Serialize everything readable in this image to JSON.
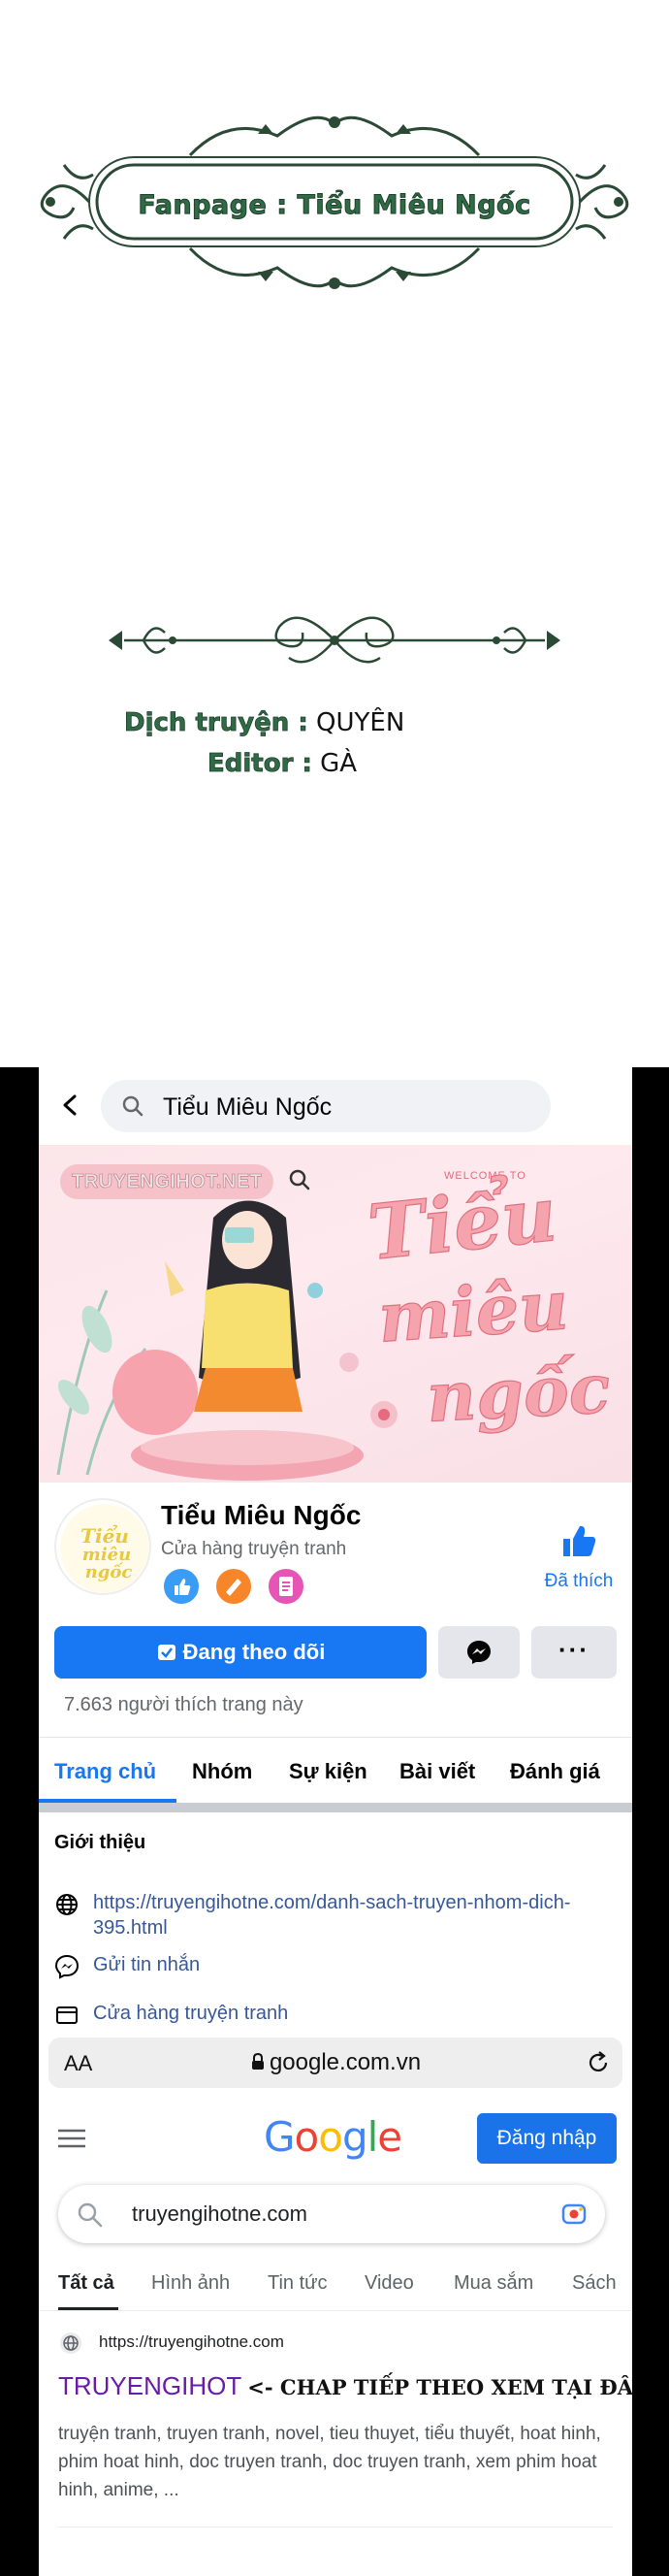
{
  "credits": {
    "fanpage": "Fanpage : Tiểu Miêu Ngốc",
    "translator_label": "Dịch truyện :",
    "translator": "QUYÊN",
    "editor_label": "Editor :",
    "editor": "GÀ",
    "accent_color": "#2f6b45"
  },
  "fb": {
    "search_query": "Tiểu Miêu Ngốc",
    "cover": {
      "site": "TRUYENGIHOT.NET",
      "welcome": "WELCOME TO",
      "title_lines": [
        "Tiểu",
        "miêu",
        "ngốc"
      ]
    },
    "page_name": "Tiểu Miêu Ngốc",
    "category": "Cửa hàng truyện tranh",
    "liked_label": "Đã thích",
    "follow_label": "Đang theo dõi",
    "more_label": "···",
    "likes_count": "7.663 người thích trang này",
    "tabs": [
      "Trang chủ",
      "Nhóm",
      "Sự kiện",
      "Bài viết",
      "Đánh giá"
    ],
    "intro": {
      "title": "Giới thiệu",
      "link": "https://truyengihotne.com/danh-sach-truyen-nhom-dich-395.html",
      "message": "Gửi tin nhắn",
      "shop": "Cửa hàng truyện tranh"
    },
    "brand_color": "#1877f2"
  },
  "browser": {
    "aa_label": "AA",
    "url": "google.com.vn"
  },
  "google": {
    "logo": "Google",
    "signin_label": "Đăng nhập",
    "query": "truyengihotne.com",
    "tabs": [
      "Tất cả",
      "Hình ảnh",
      "Tin tức",
      "Video",
      "Mua sắm",
      "Sách"
    ],
    "result": {
      "url": "https://truyengihotne.com",
      "title": "TRUYENGIHOT",
      "title_note": "<- CHAP TIẾP THEO XEM TẠI ĐÂY NHA",
      "snippet": "truyện tranh, truyen tranh, novel, tieu thuyet, tiểu thuyết, hoat hinh, phim hoat hinh, doc truyen tranh, doc truyen tranh, xem phim hoat hinh, anime, ..."
    }
  }
}
